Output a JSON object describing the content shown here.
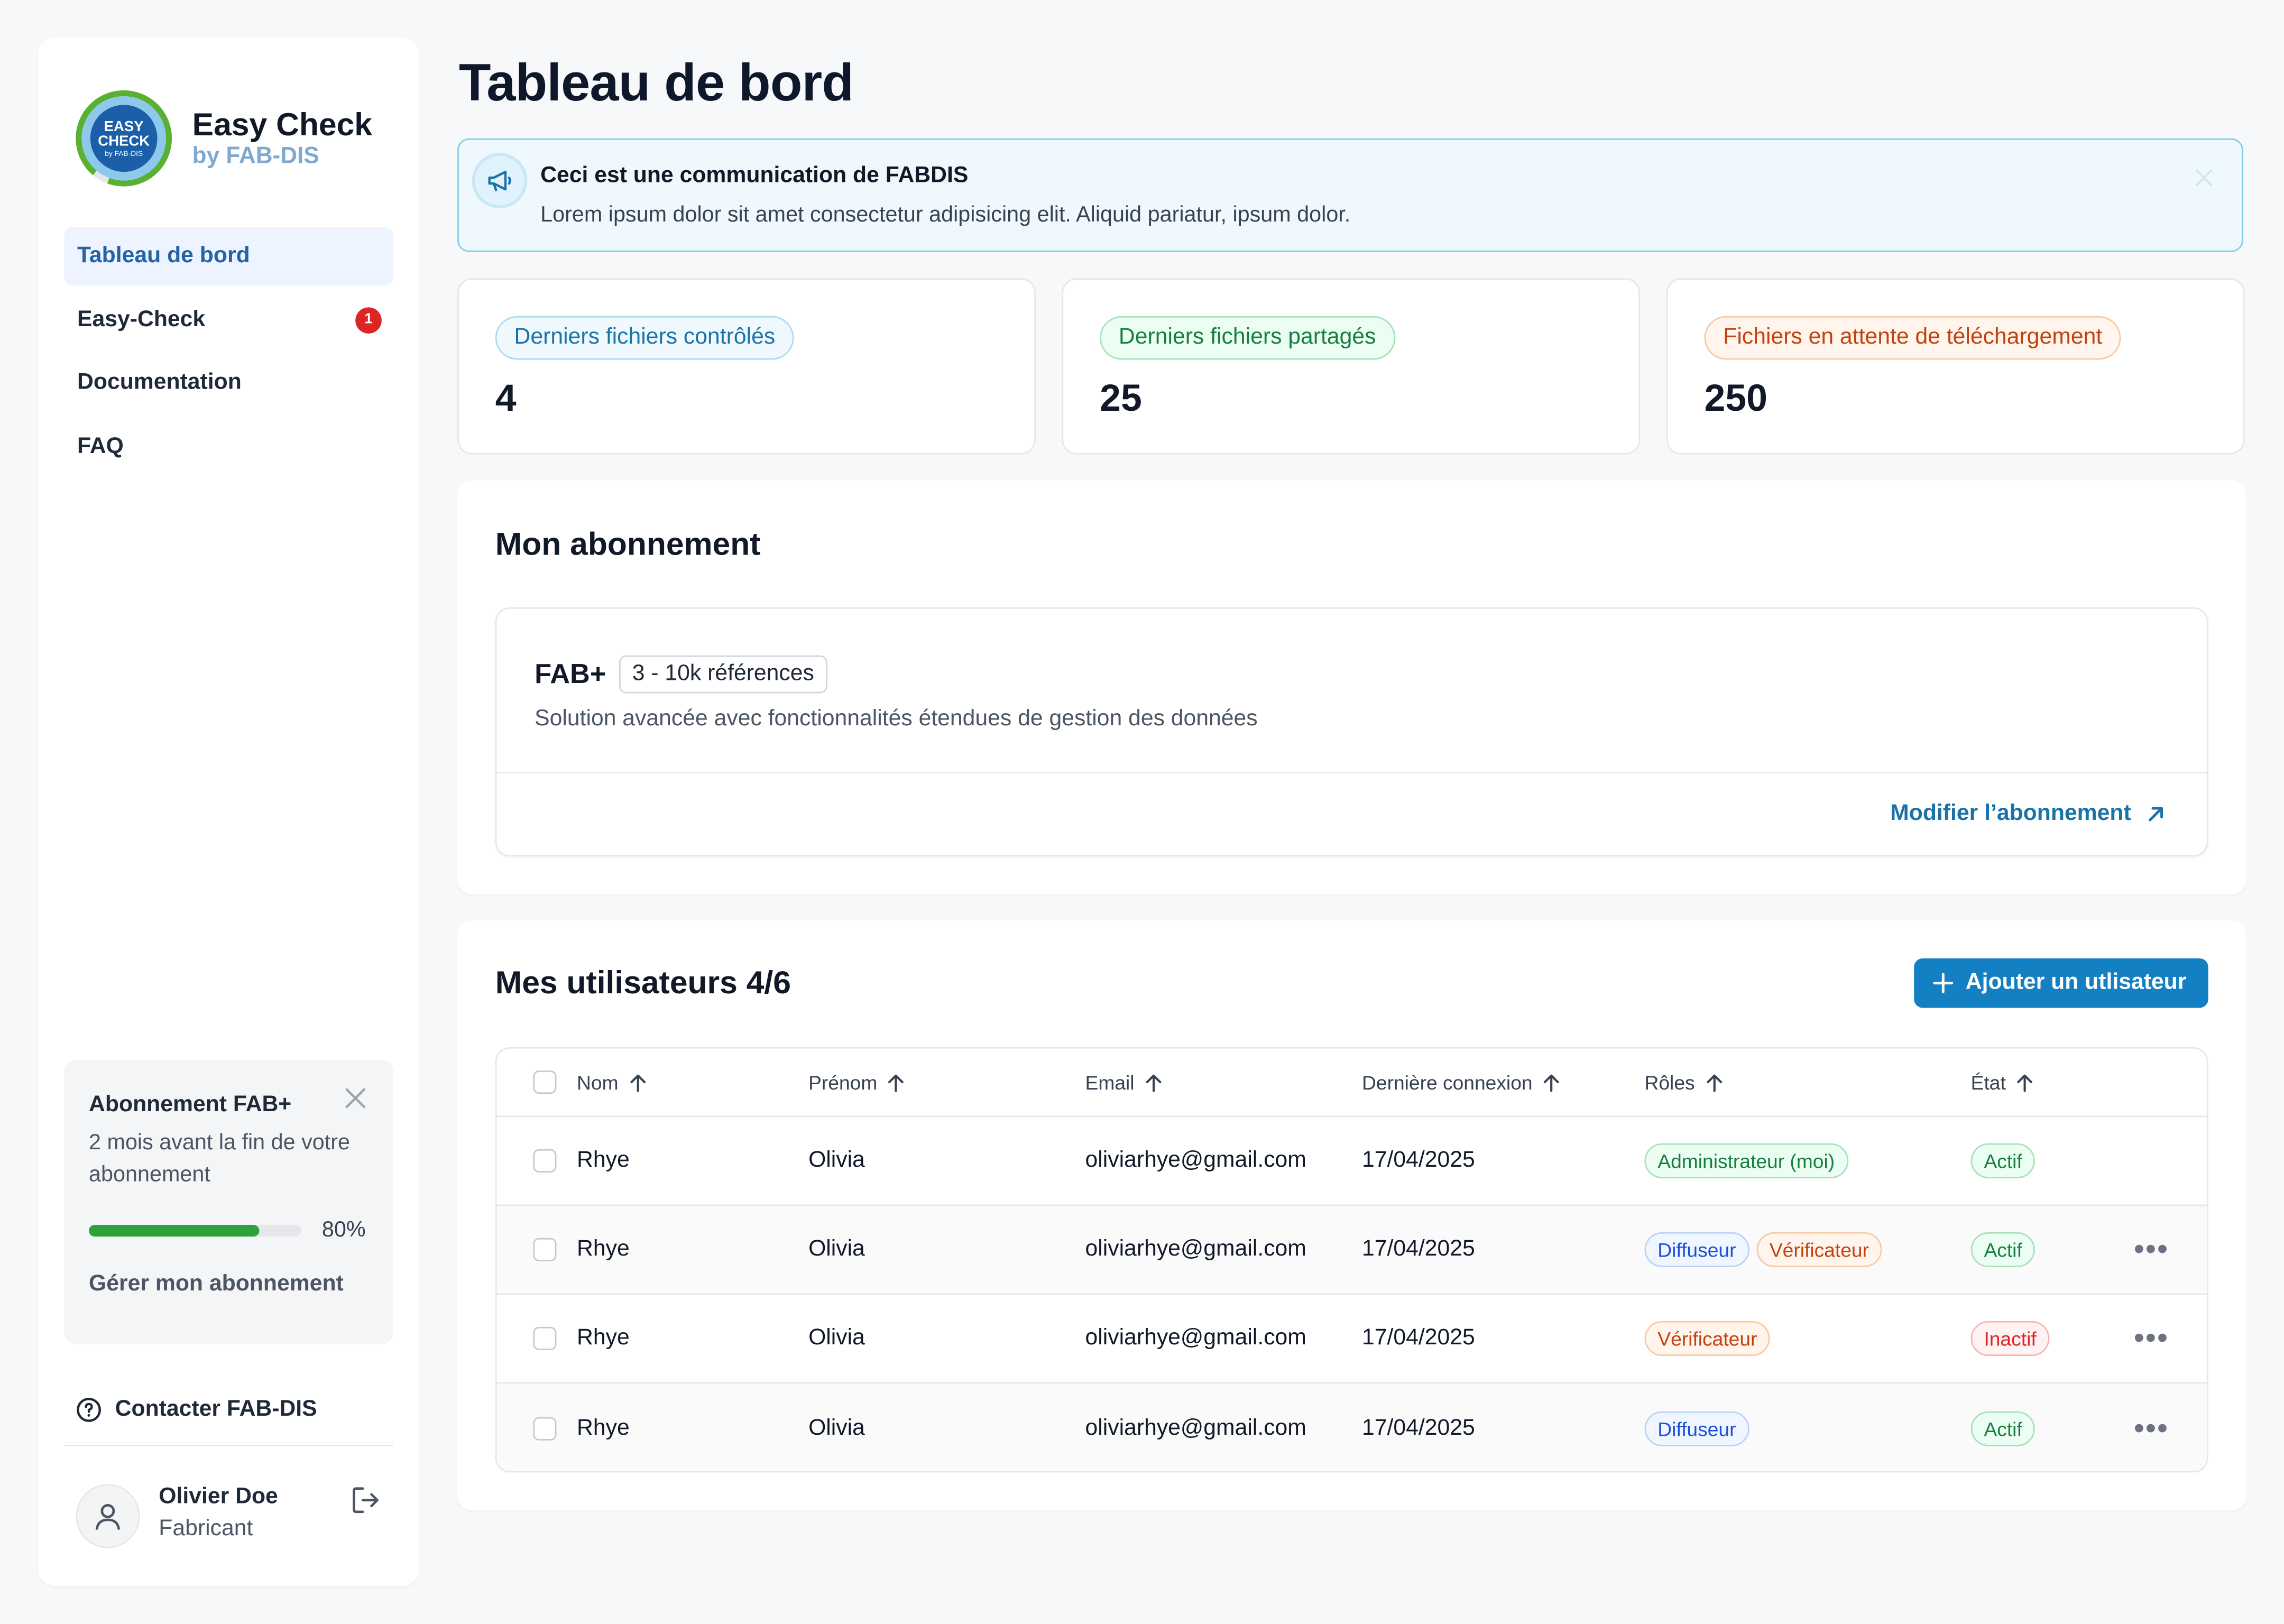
{
  "brand": {
    "logo_line1": "EASY",
    "logo_line2": "CHECK",
    "logo_line3": "by FAB-DIS",
    "title": "Easy Check",
    "subtitle": "by FAB-DIS"
  },
  "sidebar": {
    "items": [
      {
        "label": "Tableau de bord",
        "active": true
      },
      {
        "label": "Easy-Check",
        "badge": "1"
      },
      {
        "label": "Documentation"
      },
      {
        "label": "FAQ"
      }
    ],
    "subscription_card": {
      "title": "Abonnement FAB+",
      "description": "2 mois avant la fin de votre abonnement",
      "progress": 80,
      "progress_label": "80%",
      "link": "Gérer mon abonnement"
    },
    "contact": "Contacter FAB-DIS",
    "user": {
      "name": "Olivier Doe",
      "role": "Fabricant"
    }
  },
  "page": {
    "title": "Tableau de bord"
  },
  "banner": {
    "title": "Ceci est une communication de FABDIS",
    "text": "Lorem ipsum dolor sit amet consectetur adipisicing elit. Aliquid pariatur, ipsum dolor."
  },
  "stats": [
    {
      "label": "Derniers fichiers contrôlés",
      "value": "4",
      "color": "#1a73a8"
    },
    {
      "label": "Derniers fichiers partagés",
      "value": "25",
      "color": "#15803d"
    },
    {
      "label": "Fichiers en attente de téléchargement",
      "value": "250",
      "color": "#c2410c"
    }
  ],
  "subscription": {
    "section_title": "Mon abonnement",
    "plan_name": "FAB+",
    "plan_tag": "3 - 10k références",
    "plan_description": "Solution avancée avec fonctionnalités étendues de gestion des données",
    "modify_link": "Modifier l’abonnement"
  },
  "users": {
    "section_title": "Mes utilisateurs 4/6",
    "add_button": "Ajouter un utlisateur",
    "columns": [
      "Nom",
      "Prénom",
      "Email",
      "Dernière connexion",
      "Rôles",
      "État"
    ],
    "rows": [
      {
        "nom": "Rhye",
        "prenom": "Olivia",
        "email": "oliviarhye@gmail.com",
        "last": "17/04/2025",
        "roles": [
          "Administrateur (moi)"
        ],
        "state": "Actif"
      },
      {
        "nom": "Rhye",
        "prenom": "Olivia",
        "email": "oliviarhye@gmail.com",
        "last": "17/04/2025",
        "roles": [
          "Diffuseur",
          "Vérificateur"
        ],
        "state": "Actif"
      },
      {
        "nom": "Rhye",
        "prenom": "Olivia",
        "email": "oliviarhye@gmail.com",
        "last": "17/04/2025",
        "roles": [
          "Vérificateur"
        ],
        "state": "Inactif"
      },
      {
        "nom": "Rhye",
        "prenom": "Olivia",
        "email": "oliviarhye@gmail.com",
        "last": "17/04/2025",
        "roles": [
          "Diffuseur"
        ],
        "state": "Actif"
      }
    ]
  },
  "colors": {
    "accent": "#1380c4",
    "progress": "#2ba33a",
    "badge": "#dc2626"
  }
}
